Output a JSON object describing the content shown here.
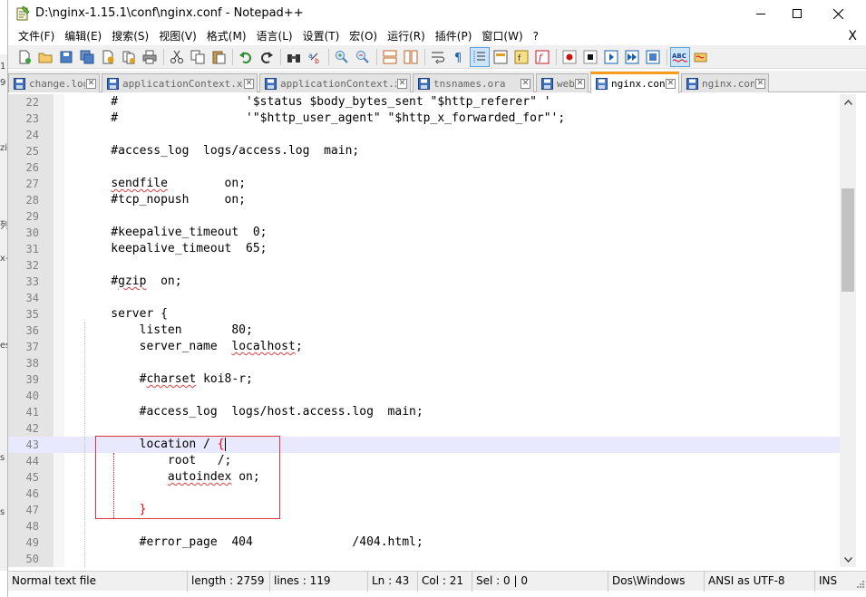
{
  "window": {
    "title": "D:\\nginx-1.15.1\\conf\\nginx.conf - Notepad++"
  },
  "menu": [
    {
      "label": "文件(F)",
      "name": "menu-file"
    },
    {
      "label": "编辑(E)",
      "name": "menu-edit"
    },
    {
      "label": "搜索(S)",
      "name": "menu-search"
    },
    {
      "label": "视图(V)",
      "name": "menu-view"
    },
    {
      "label": "格式(M)",
      "name": "menu-format"
    },
    {
      "label": "语言(L)",
      "name": "menu-language"
    },
    {
      "label": "设置(T)",
      "name": "menu-settings"
    },
    {
      "label": "宏(O)",
      "name": "menu-macro"
    },
    {
      "label": "运行(R)",
      "name": "menu-run"
    },
    {
      "label": "插件(P)",
      "name": "menu-plugins"
    },
    {
      "label": "窗口(W)",
      "name": "menu-window"
    },
    {
      "label": "?",
      "name": "menu-help"
    }
  ],
  "menu_close": "X",
  "tabs": [
    {
      "label": "change.log",
      "icon": "save-state-icon",
      "active": false
    },
    {
      "label": "applicationContext.xml",
      "icon": "save-state-icon",
      "active": false
    },
    {
      "label": "applicationContext.xml",
      "icon": "save-state-icon",
      "active": false
    },
    {
      "label": "tnsnames.ora",
      "icon": "save-state-icon",
      "active": false
    },
    {
      "label": "web.xml",
      "icon": "save-state-icon",
      "active": false
    },
    {
      "label": "nginx.conf",
      "icon": "save-state-icon",
      "active": true
    },
    {
      "label": "nginx.conf",
      "icon": "save-state-icon",
      "active": false
    }
  ],
  "tab_close_glyph": "✕",
  "left_strip_fragments": [
    "1",
    "9",
    "zi",
    "列",
    "x-",
    "es",
    "s",
    "s"
  ],
  "editor": {
    "current_line": 43,
    "lines": [
      {
        "n": "22",
        "text": "    #                  '$status $body_bytes_sent \"$http_referer\" '"
      },
      {
        "n": "23",
        "text": "    #                  '\"$http_user_agent\" \"$http_x_forwarded_for\"';"
      },
      {
        "n": "24",
        "text": ""
      },
      {
        "n": "25",
        "text": "    #access_log  logs/access.log  main;"
      },
      {
        "n": "26",
        "text": ""
      },
      {
        "n": "27",
        "text": "    sendfile        on;"
      },
      {
        "n": "28",
        "text": "    #tcp_nopush     on;"
      },
      {
        "n": "29",
        "text": ""
      },
      {
        "n": "30",
        "text": "    #keepalive_timeout  0;"
      },
      {
        "n": "31",
        "text": "    keepalive_timeout  65;"
      },
      {
        "n": "32",
        "text": ""
      },
      {
        "n": "33",
        "text": "    #gzip  on;"
      },
      {
        "n": "34",
        "text": ""
      },
      {
        "n": "35",
        "text": "    server {"
      },
      {
        "n": "36",
        "text": "        listen       80;"
      },
      {
        "n": "37",
        "text": "        server_name  localhost;"
      },
      {
        "n": "38",
        "text": ""
      },
      {
        "n": "39",
        "text": "        #charset koi8-r;"
      },
      {
        "n": "40",
        "text": ""
      },
      {
        "n": "41",
        "text": "        #access_log  logs/host.access.log  main;"
      },
      {
        "n": "42",
        "text": ""
      },
      {
        "n": "43",
        "text": "        location / {"
      },
      {
        "n": "44",
        "text": "            root   /;"
      },
      {
        "n": "45",
        "text": "            autoindex on;"
      },
      {
        "n": "46",
        "text": ""
      },
      {
        "n": "47",
        "text": "        }"
      },
      {
        "n": "48",
        "text": ""
      },
      {
        "n": "49",
        "text": "        #error_page  404              /404.html;"
      },
      {
        "n": "50",
        "text": ""
      }
    ]
  },
  "status": {
    "file_type": "Normal text file",
    "length": "length : 2759",
    "lines": "lines : 119",
    "ln": "Ln : 43",
    "col": "Col : 21",
    "sel": "Sel : 0 | 0",
    "eol": "Dos\\Windows",
    "encoding": "ANSI as UTF-8",
    "mode": "INS"
  },
  "colors": {
    "current_line": "#e8e8ff",
    "active_tab_accent": "#fa9c1b",
    "highlight_box": "#d9383e",
    "brace_match": "#ff0000"
  }
}
